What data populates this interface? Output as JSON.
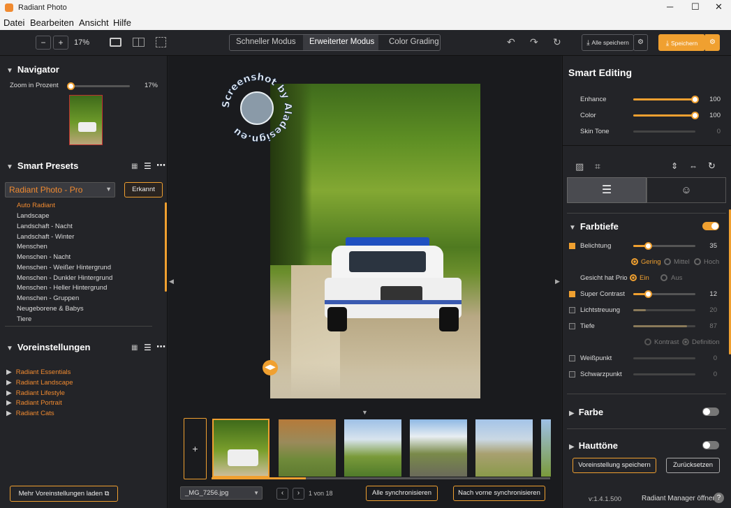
{
  "app": {
    "title": "Radiant Photo"
  },
  "menu": [
    "Datei",
    "Bearbeiten",
    "Ansicht",
    "Hilfe"
  ],
  "toolbar": {
    "zoom": "17%",
    "modes": [
      "Schneller Modus",
      "Erweiterter Modus",
      "Color Grading"
    ],
    "save_all": "Alle speichern",
    "save": "Speichern"
  },
  "navigator": {
    "title": "Navigator",
    "zoom_label": "Zoom in Prozent",
    "zoom_value": "17%",
    "zoom_level": 0.0
  },
  "smart_presets": {
    "title": "Smart Presets",
    "dropdown": "Radiant Photo - Pro",
    "detected_button": "Erkannt",
    "items": [
      "Auto Radiant",
      "Landscape",
      "Landschaft - Nacht",
      "Landschaft - Winter",
      "Menschen",
      "Menschen - Nacht",
      "Menschen - Weißer Hintergrund",
      "Menschen - Dunkler Hintergrund",
      "Menschen - Heller Hintergrund",
      "Menschen - Gruppen",
      "Neugeborene & Babys",
      "Tiere"
    ]
  },
  "voreinstellungen": {
    "title": "Voreinstellungen",
    "items": [
      "Radiant Essentials",
      "Radiant Landscape",
      "Radiant Lifestyle",
      "Radiant Portrait",
      "Radiant Cats"
    ],
    "load_more": "Mehr Voreinstellungen laden"
  },
  "watermark": "Screenshot by Aladesign.eu",
  "filmstrip": {
    "filename": "_MG_7256.jpg",
    "counter": "1 von 18",
    "sync_all": "Alle synchronisieren",
    "sync_forward": "Nach vorne synchronisieren",
    "add": "+"
  },
  "smart_editing": {
    "title": "Smart Editing",
    "sliders": [
      {
        "label": "Enhance",
        "value": "100",
        "level": 1.0
      },
      {
        "label": "Color",
        "value": "100",
        "level": 1.0
      },
      {
        "label": "Skin Tone",
        "value": "0",
        "level": 0.0
      }
    ]
  },
  "farbtiefe": {
    "title": "Farbtiefe",
    "belichtung": {
      "label": "Belichtung",
      "value": "35",
      "level": 0.24
    },
    "belichtung_options": [
      "Gering",
      "Mittel",
      "Hoch"
    ],
    "gesicht_label": "Gesicht hat Prio",
    "gesicht_options": [
      "Ein",
      "Aus"
    ],
    "super_contrast": {
      "label": "Super Contrast",
      "value": "12",
      "level": 0.24
    },
    "lichtstreuung": {
      "label": "Lichtstreuung",
      "value": "20",
      "level": 0.2
    },
    "tiefe": {
      "label": "Tiefe",
      "value": "87",
      "level": 0.87
    },
    "tiefe_options": [
      "Kontrast",
      "Definition"
    ],
    "weisspunkt": {
      "label": "Weißpunkt",
      "value": "0",
      "level": 0.0
    },
    "schwarzpunkt": {
      "label": "Schwarzpunkt",
      "value": "0",
      "level": 0.0
    }
  },
  "farbe": {
    "title": "Farbe"
  },
  "hauttoene": {
    "title": "Hauttöne"
  },
  "footer": {
    "save_preset": "Voreinstellung speichern",
    "reset": "Zurücksetzen",
    "version": "v:1.4.1.500",
    "manager": "Radiant Manager öffnen"
  },
  "colors": {
    "accent": "#f0a030",
    "preset_orange": "#f08a30"
  }
}
